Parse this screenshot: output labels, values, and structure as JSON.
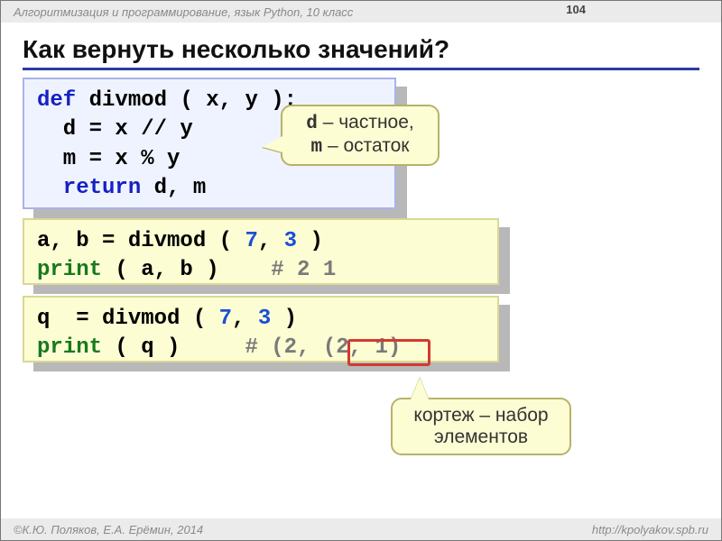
{
  "header": {
    "course": "Алгоритмизация и программирование, язык Python, 10 класс",
    "page_number": "104"
  },
  "title": "Как вернуть несколько значений?",
  "code1": {
    "l1_def": "def",
    "l1_rest": " divmod ( x, y ):",
    "l2": "  d = x // y",
    "l3": "  m = x % y",
    "l4_ret": "  return",
    "l4_rest": " d, m"
  },
  "callout1": {
    "d": "d",
    "d_txt": " – частное,",
    "m": "m",
    "m_txt": " – остаток"
  },
  "code2": {
    "l1_a": "a, b = divmod ( ",
    "n1": "7",
    "comma": ", ",
    "n2": "3",
    "l1_b": " )",
    "l2_p": "print",
    "l2_a": " ( a, b )    ",
    "l2_c": "# 2 1"
  },
  "code3": {
    "l1_a": "q  = divmod ( ",
    "n1": "7",
    "comma": ", ",
    "n2": "3",
    "l1_b": " )",
    "l2_p": "print",
    "l2_a": " ( q )     ",
    "l2_c": "# (2, ",
    "l2_d": "(2, 1)"
  },
  "callout2": {
    "l1": "кортеж – набор",
    "l2": "элементов"
  },
  "footer": {
    "left": "К.Ю. Поляков, Е.А. Ерёмин, 2014",
    "right": "http://kpolyakov.spb.ru",
    "copy": "©"
  }
}
